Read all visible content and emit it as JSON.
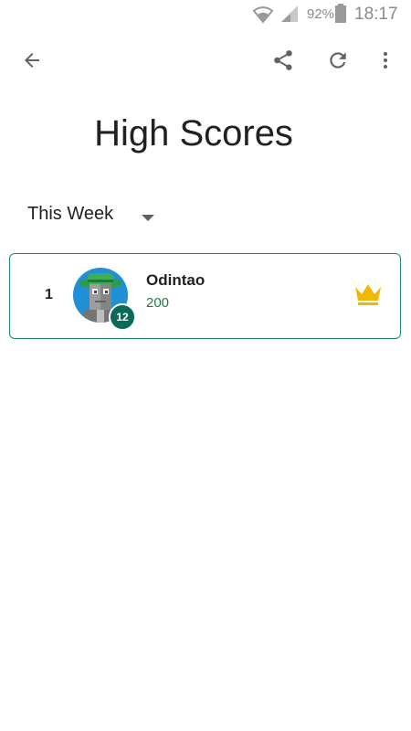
{
  "status_bar": {
    "battery_percent": "92%",
    "time": "18:17",
    "icons": [
      "wifi-icon",
      "signal-icon",
      "battery-icon"
    ]
  },
  "toolbar": {
    "back_icon": "arrow-back-icon",
    "share_icon": "share-icon",
    "refresh_icon": "refresh-icon",
    "menu_icon": "more-vert-icon"
  },
  "page": {
    "title": "High Scores"
  },
  "filter": {
    "selected": "This Week"
  },
  "leaderboard": [
    {
      "rank": "1",
      "name": "Odintao",
      "score": "200",
      "level": "12"
    }
  ],
  "colors": {
    "accent_green": "#1e8e5e",
    "score_green": "#1e7d44",
    "badge": "#0b6b5a",
    "crown": "#f2b705"
  }
}
